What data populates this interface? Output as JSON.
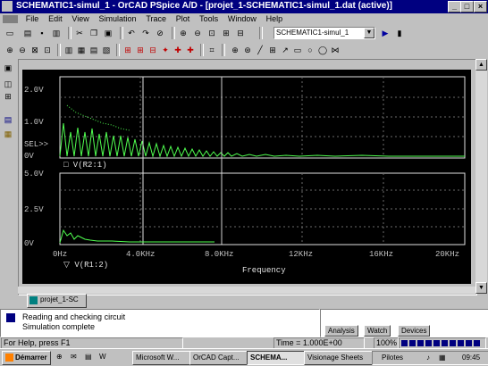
{
  "window": {
    "title": "SCHEMATIC1-simul_1 - OrCAD PSpice A/D - [projet_1-SCHEMATIC1-simul_1.dat (active)]",
    "controls": [
      "_",
      "□",
      "×"
    ]
  },
  "menu": [
    "File",
    "Edit",
    "View",
    "Simulation",
    "Trace",
    "Plot",
    "Tools",
    "Window",
    "Help"
  ],
  "toolbar": {
    "profile": "SCHEMATIC1-simul_1"
  },
  "plot": {
    "upper_ticks": [
      "2.0V",
      "1.0V",
      "SEL>>",
      "0V"
    ],
    "upper_legend": "□ V(R2:1)",
    "lower_ticks": [
      "5.0V",
      "2.5V",
      "0V"
    ],
    "lower_legend": "▽ V(R1:2)",
    "x_ticks": [
      "0Hz",
      "4.0KHz",
      "8.0KHz",
      "12KHz",
      "16KHz",
      "20KHz"
    ],
    "x_label": "Frequency"
  },
  "tab": "projet_1-SC",
  "output": {
    "lines": [
      "Reading and checking circuit",
      "Simulation complete"
    ]
  },
  "sim_tabs": [
    "Analysis",
    "Watch",
    "Devices"
  ],
  "status": {
    "help": "For Help, press F1",
    "time": "Time = 1.000E+00",
    "percent": "100%"
  },
  "taskbar": {
    "start": "Démarrer",
    "items": [
      "Microsoft W...",
      "OrCAD Capt...",
      "SCHEMA...",
      "Visionage Sheets"
    ],
    "tray": "Pilotes",
    "clock": "09:45"
  }
}
